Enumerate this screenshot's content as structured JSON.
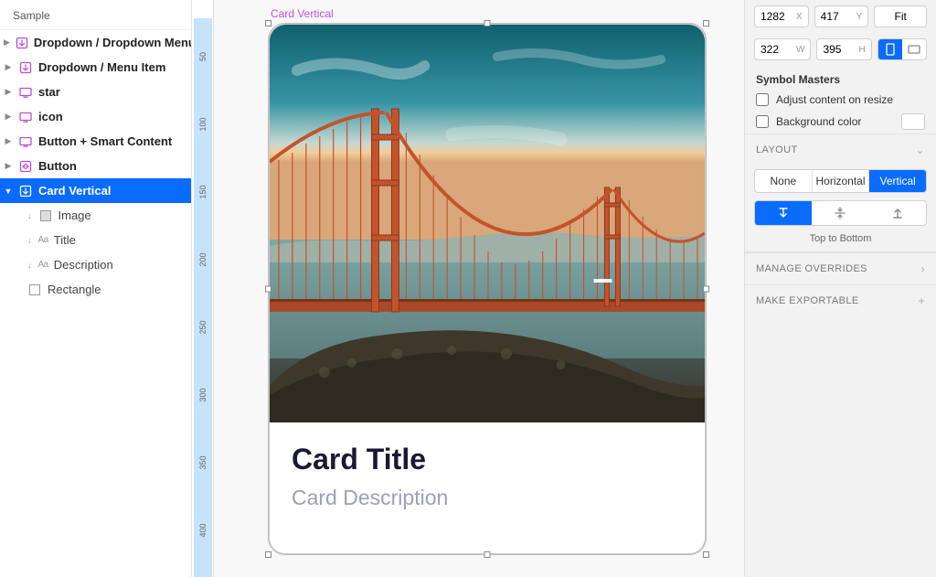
{
  "sidebar": {
    "title": "Sample",
    "layers": [
      {
        "label": "Dropdown / Dropdown Menu",
        "type": "symbol",
        "expanded": false
      },
      {
        "label": "Dropdown / Menu Item",
        "type": "symbol",
        "expanded": false
      },
      {
        "label": "star",
        "type": "symbol-h",
        "expanded": false
      },
      {
        "label": "icon",
        "type": "symbol-h",
        "expanded": false
      },
      {
        "label": "Button + Smart Content",
        "type": "symbol-h",
        "expanded": false
      },
      {
        "label": "Button",
        "type": "symbol-b",
        "expanded": false
      },
      {
        "label": "Card Vertical",
        "type": "symbol",
        "expanded": true,
        "selected": true
      }
    ],
    "children": [
      {
        "label": "Image",
        "type": "image"
      },
      {
        "label": "Title",
        "type": "text"
      },
      {
        "label": "Description",
        "type": "text"
      },
      {
        "label": "Rectangle",
        "type": "rect"
      }
    ]
  },
  "canvas": {
    "selection_label": "Card Vertical",
    "ruler_ticks": [
      "50",
      "100",
      "150",
      "200",
      "250",
      "300",
      "350",
      "400"
    ],
    "card": {
      "title": "Card Title",
      "description": "Card Description"
    }
  },
  "inspector": {
    "x": "1282",
    "y": "417",
    "w": "322",
    "h": "395",
    "fit_label": "Fit",
    "symbol_masters_label": "Symbol Masters",
    "adjust_label": "Adjust content on resize",
    "bgcolor_label": "Background color",
    "layout_label": "LAYOUT",
    "layout_options": [
      "None",
      "Horizontal",
      "Vertical"
    ],
    "layout_selected": "Vertical",
    "direction_caption": "Top to Bottom",
    "manage_overrides_label": "MANAGE OVERRIDES",
    "make_exportable_label": "MAKE EXPORTABLE"
  }
}
